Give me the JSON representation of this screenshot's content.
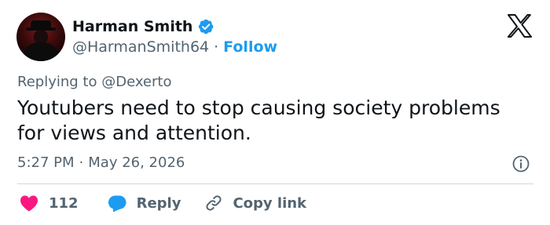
{
  "author": {
    "display_name": "Harman Smith",
    "handle": "@HarmanSmith64",
    "separator": "·",
    "follow_label": "Follow",
    "verified": true
  },
  "reply_context": {
    "prefix": "Replying to",
    "mention": "@Dexerto"
  },
  "tweet": {
    "text": "Youtubers need to stop causing society problems\nfor views and attention.",
    "time": "5:27 PM",
    "separator": "·",
    "date": "May 26, 2026"
  },
  "actions": {
    "like_count": "112",
    "reply_label": "Reply",
    "copy_link_label": "Copy link"
  },
  "colors": {
    "accent": "#1d9bf0",
    "like": "#f91880",
    "text": "#0f1419",
    "secondary": "#536471"
  },
  "icons": [
    "verified-badge-icon",
    "x-logo-icon",
    "info-icon",
    "heart-icon",
    "reply-bubble-icon",
    "link-icon"
  ]
}
